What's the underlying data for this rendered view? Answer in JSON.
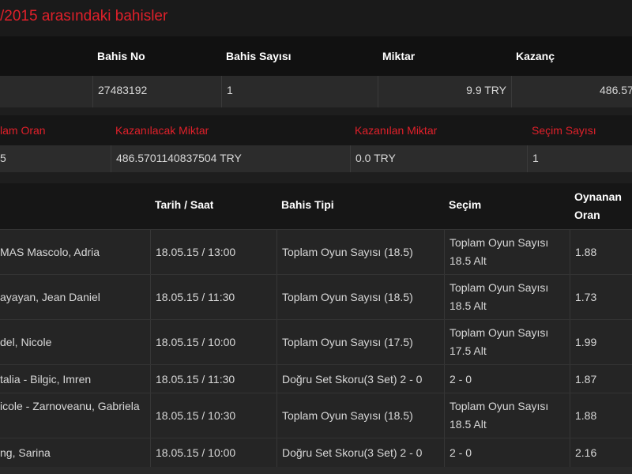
{
  "title": "/2015 arasındaki bahisler",
  "summary": {
    "headers": [
      "Bahis No",
      "Bahis Sayısı",
      "Miktar",
      "Kazanç"
    ],
    "values": [
      "27483192",
      "1",
      "9.9 TRY",
      "486.57"
    ]
  },
  "detail": {
    "headers": [
      "lam Oran",
      "Kazanılacak Miktar",
      "Kazanılan Miktar",
      "Seçim Sayısı"
    ],
    "values": [
      "5",
      "486.5701140837504 TRY",
      "0.0 TRY",
      "1"
    ]
  },
  "bets_table": {
    "headers": [
      "",
      "Tarih / Saat",
      "Bahis Tipi",
      "Seçim",
      "Oynanan Oran"
    ],
    "rows": [
      {
        "event": "MAS Mascolo, Adria",
        "datetime": "18.05.15 / 13:00",
        "bet_type": "Toplam Oyun Sayısı (18.5)",
        "selection": "Toplam Oyun Sayısı 18.5 Alt",
        "odds": "1.88"
      },
      {
        "event": "ayayan, Jean Daniel",
        "datetime": "18.05.15 / 11:30",
        "bet_type": "Toplam Oyun Sayısı (18.5)",
        "selection": "Toplam Oyun Sayısı 18.5 Alt",
        "odds": "1.73"
      },
      {
        "event": "del, Nicole",
        "datetime": "18.05.15 / 10:00",
        "bet_type": "Toplam Oyun Sayısı (17.5)",
        "selection": "Toplam Oyun Sayısı 17.5 Alt",
        "odds": "1.99"
      },
      {
        "event": "talia - Bilgic, Imren",
        "datetime": "18.05.15 / 11:30",
        "bet_type": "Doğru Set Skoru(3 Set) 2 - 0",
        "selection": "2 - 0",
        "odds": "1.87"
      },
      {
        "event": "icole - Zarnoveanu, Gabriela",
        "datetime": "18.05.15 / 10:30",
        "bet_type": "Toplam Oyun Sayısı (18.5)",
        "selection": "Toplam Oyun Sayısı 18.5 Alt",
        "odds": "1.88"
      },
      {
        "event": "ng, Sarina",
        "datetime": "18.05.15 / 10:00",
        "bet_type": "Doğru Set Skoru(3 Set) 2 - 0",
        "selection": "2 - 0",
        "odds": "2.16"
      }
    ]
  },
  "colors": {
    "accent": "#e0202a",
    "background": "#1c1c1c"
  }
}
